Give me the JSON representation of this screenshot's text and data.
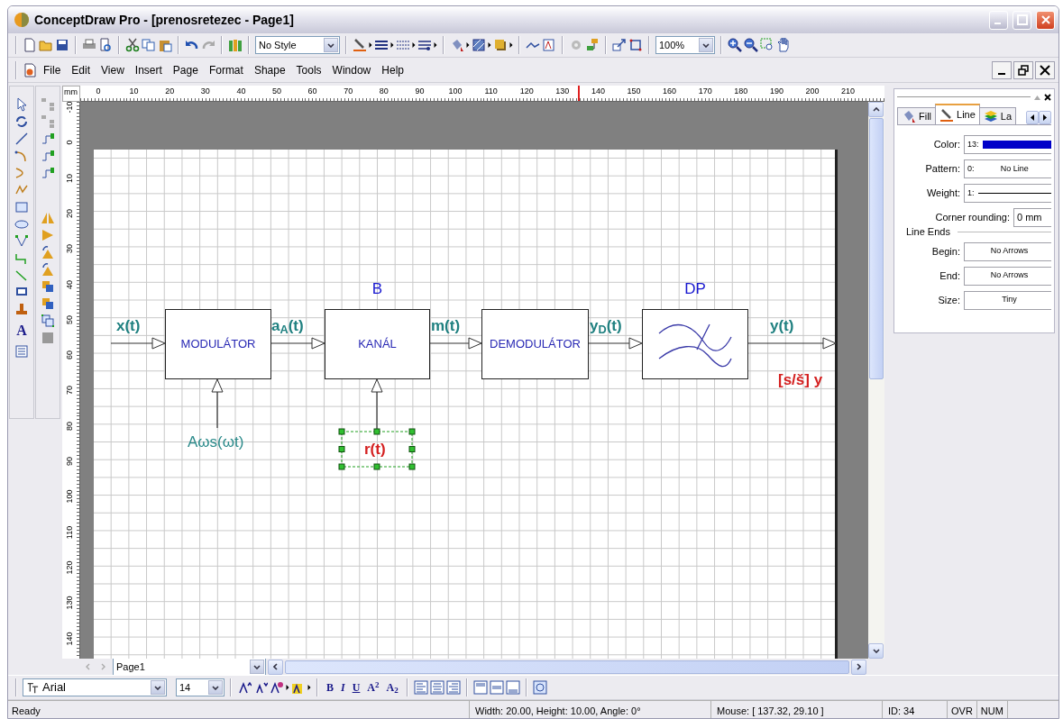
{
  "window": {
    "title": "ConceptDraw Pro - [prenosretezec - Page1]"
  },
  "toolbar": {
    "style_combo": "No Style",
    "zoom_combo": "100%"
  },
  "menu": [
    "File",
    "Edit",
    "View",
    "Insert",
    "Page",
    "Format",
    "Shape",
    "Tools",
    "Window",
    "Help"
  ],
  "toolbox": {
    "text_tool": "A"
  },
  "ruler": {
    "unit": "mm",
    "horizontal": [
      "0",
      "10",
      "20",
      "30",
      "40",
      "50",
      "60",
      "70",
      "80",
      "90",
      "100",
      "110",
      "120",
      "130",
      "140",
      "150",
      "160",
      "170",
      "180",
      "190",
      "200",
      "210"
    ],
    "vertical": [
      "-10",
      "0",
      "10",
      "20",
      "30",
      "40",
      "50",
      "60",
      "70",
      "80",
      "90",
      "100",
      "110",
      "120",
      "130",
      "140"
    ]
  },
  "diagram": {
    "blocks": [
      {
        "kind": "box",
        "label": "MODULÁTOR"
      },
      {
        "kind": "box",
        "label": "KANÁL",
        "caption": "B"
      },
      {
        "kind": "box",
        "label": "DEMODULÁTOR"
      },
      {
        "kind": "filter",
        "caption": "DP"
      }
    ],
    "signals": [
      "x(t)",
      "a$_{A}$(t)",
      "m(t)",
      "y$_{D}$(t)",
      "y(t)"
    ],
    "inputs": [
      {
        "label": "Aωs(ωt)",
        "selected": false,
        "color": "#2a8a8a"
      },
      {
        "label": "r(t)",
        "selected": true,
        "color": "#d42020"
      }
    ],
    "note": "[s/š] y"
  },
  "page_tabs": {
    "current": "Page1"
  },
  "properties_panel": {
    "tabs": [
      {
        "label": "Fill",
        "selected": false
      },
      {
        "label": "Line",
        "selected": true
      },
      {
        "label": "La",
        "selected": false
      }
    ],
    "fields": [
      {
        "kind": "color",
        "label": "Color:",
        "index": "13:",
        "color": "#0000c8"
      },
      {
        "kind": "text",
        "label": "Pattern:",
        "index": "0:",
        "value": "No Line"
      },
      {
        "kind": "line",
        "label": "Weight:",
        "index": "1:"
      }
    ],
    "corner": {
      "label": "Corner rounding:",
      "value": "0 mm"
    },
    "section": "Line Ends",
    "end_fields": [
      {
        "label": "Begin:",
        "value": "No Arrows"
      },
      {
        "label": "End:",
        "value": "No Arrows"
      },
      {
        "label": "Size:",
        "value": "Tiny"
      }
    ]
  },
  "format_toolbar": {
    "font": "Arial",
    "size": "14",
    "style_buttons": [
      "B",
      "I",
      "U",
      "A$^{2}$",
      "A$_{2}$"
    ]
  },
  "status_bar": {
    "state": "Ready",
    "geometry": "Width: 20.00,  Height: 10.00,  Angle: 0°",
    "mouse": "Mouse: [ 137.32, 29.10 ]",
    "id": "ID: 34",
    "ovr": "OVR",
    "num": "NUM"
  }
}
